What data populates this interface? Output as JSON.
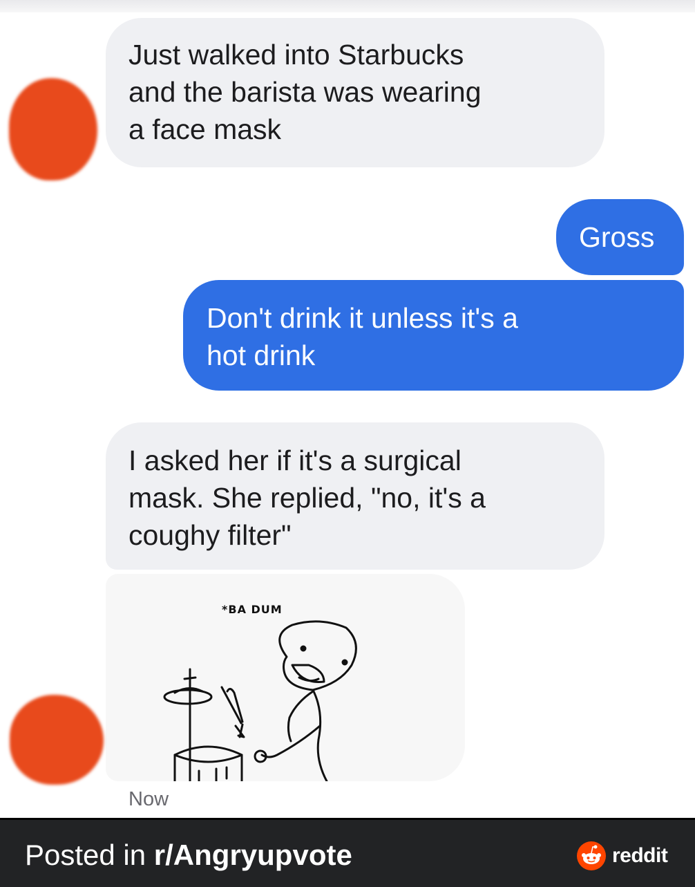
{
  "messages": [
    {
      "direction": "incoming",
      "lines": [
        "Just walked into Starbucks",
        "and the barista was wearing",
        "a face mask"
      ]
    },
    {
      "direction": "outgoing",
      "lines": [
        "Gross"
      ]
    },
    {
      "direction": "outgoing",
      "lines": [
        "Don't drink it unless it's a",
        "hot drink"
      ]
    },
    {
      "direction": "incoming",
      "lines": [
        "I asked her if it's a surgical",
        "mask. She replied, \"no, it's a",
        "coughy filter\""
      ]
    }
  ],
  "image_message": {
    "caption": "*BA DUM"
  },
  "timestamp": "Now",
  "footer": {
    "prefix": "Posted in ",
    "subreddit": "r/Angryupvote",
    "brand": "reddit"
  },
  "colors": {
    "outgoing_bubble": "#2f6fe4",
    "incoming_bubble": "#eff0f3",
    "avatar_redaction": "#e84a1c",
    "footer_bg": "#222325",
    "reddit_orange": "#ff4500"
  },
  "icons": {
    "reddit_logo": "reddit-alien-icon",
    "drummer_drawing": "stick-figure-drummer"
  }
}
